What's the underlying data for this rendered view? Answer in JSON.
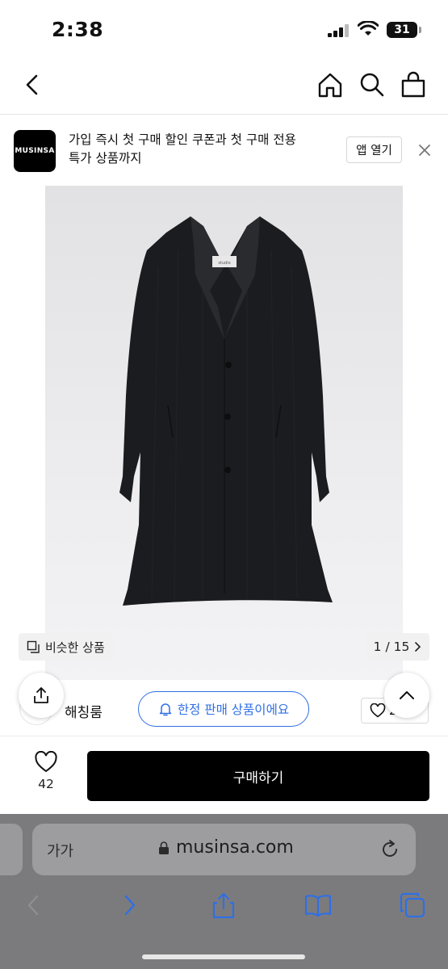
{
  "status_bar": {
    "time": "2:38",
    "battery": "31"
  },
  "banner": {
    "logo_text": "MUSINSA",
    "line1": "가입 즉시 첫 구매 할인 쿠폰과 첫 구매 전용",
    "line2": "특가 상품까지",
    "open_label": "앱 열기"
  },
  "gallery": {
    "similar_label": "비슷한 상품",
    "pager": "1 / 15",
    "coat_label_tag": "studio"
  },
  "brand_row": {
    "brand_name": "해칭룸",
    "limited_label": "한정 판매 상품이에요",
    "like_count_visible": "2"
  },
  "buy_bar": {
    "wish_count": "42",
    "buy_label": "구매하기"
  },
  "safari": {
    "aa_label": "가가",
    "url": "musinsa.com"
  },
  "colors": {
    "accent_blue": "#2f6fe4",
    "buy_button": "#000000",
    "safari_bar": "#7b7b7e"
  },
  "icons": [
    "back-icon",
    "home-icon",
    "search-icon",
    "bag-icon",
    "close-icon",
    "similar-icon",
    "chevron-right-icon",
    "share-icon",
    "chevron-up-icon",
    "bell-icon",
    "heart-icon",
    "lock-icon",
    "reload-icon",
    "safari-back-icon",
    "safari-forward-icon",
    "safari-share-icon",
    "bookmarks-icon",
    "tabs-icon"
  ]
}
